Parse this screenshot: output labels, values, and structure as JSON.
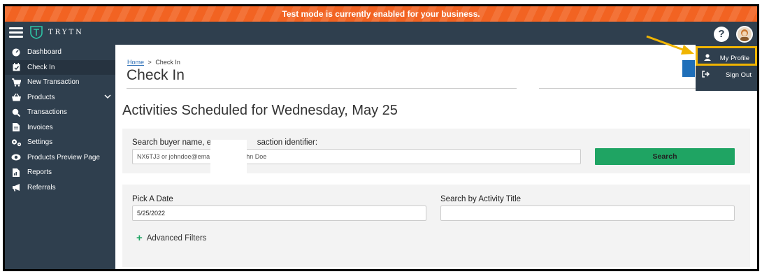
{
  "banner": {
    "text": "Test mode is currently enabled for your business."
  },
  "topbar": {
    "logo_text": "TRYTN",
    "help_label": "?"
  },
  "sidebar": {
    "items": [
      {
        "label": "Dashboard",
        "icon": "dashboard-icon"
      },
      {
        "label": "Check In",
        "icon": "calendar-check-icon",
        "active": true
      },
      {
        "label": "New Transaction",
        "icon": "cart-icon"
      },
      {
        "label": "Products",
        "icon": "basket-icon",
        "has_submenu": true
      },
      {
        "label": "Transactions",
        "icon": "search-dollar-icon"
      },
      {
        "label": "Invoices",
        "icon": "file-icon"
      },
      {
        "label": "Settings",
        "icon": "gears-icon"
      },
      {
        "label": "Products Preview Page",
        "icon": "eye-icon"
      },
      {
        "label": "Reports",
        "icon": "report-icon"
      },
      {
        "label": "Referrals",
        "icon": "megaphone-icon"
      }
    ]
  },
  "breadcrumb": {
    "home": "Home",
    "separator": ">",
    "current": "Check In"
  },
  "page": {
    "title": "Check In",
    "heading": "Activities Scheduled for Wednesday, May 25"
  },
  "search": {
    "label": "Search buyer name, em",
    "label_tail": "saction identifier:",
    "placeholder_head": "NX6TJ3 or johndoe@ema",
    "placeholder_tail": "hn Doe",
    "button": "Search"
  },
  "filters": {
    "date_label": "Pick A Date",
    "date_value": "5/25/2022",
    "title_label": "Search by Activity Title",
    "title_value": "",
    "advanced": "Advanced Filters"
  },
  "user_menu": {
    "items": [
      {
        "label": "My Profile",
        "icon": "user-icon",
        "highlighted": true
      },
      {
        "label": "Sign Out",
        "icon": "sign-out-icon"
      }
    ]
  },
  "colors": {
    "banner": "#f26322",
    "nav": "#2f3f4e",
    "search_button": "#1fa463",
    "highlight": "#f0b400",
    "link": "#2a6db5"
  }
}
